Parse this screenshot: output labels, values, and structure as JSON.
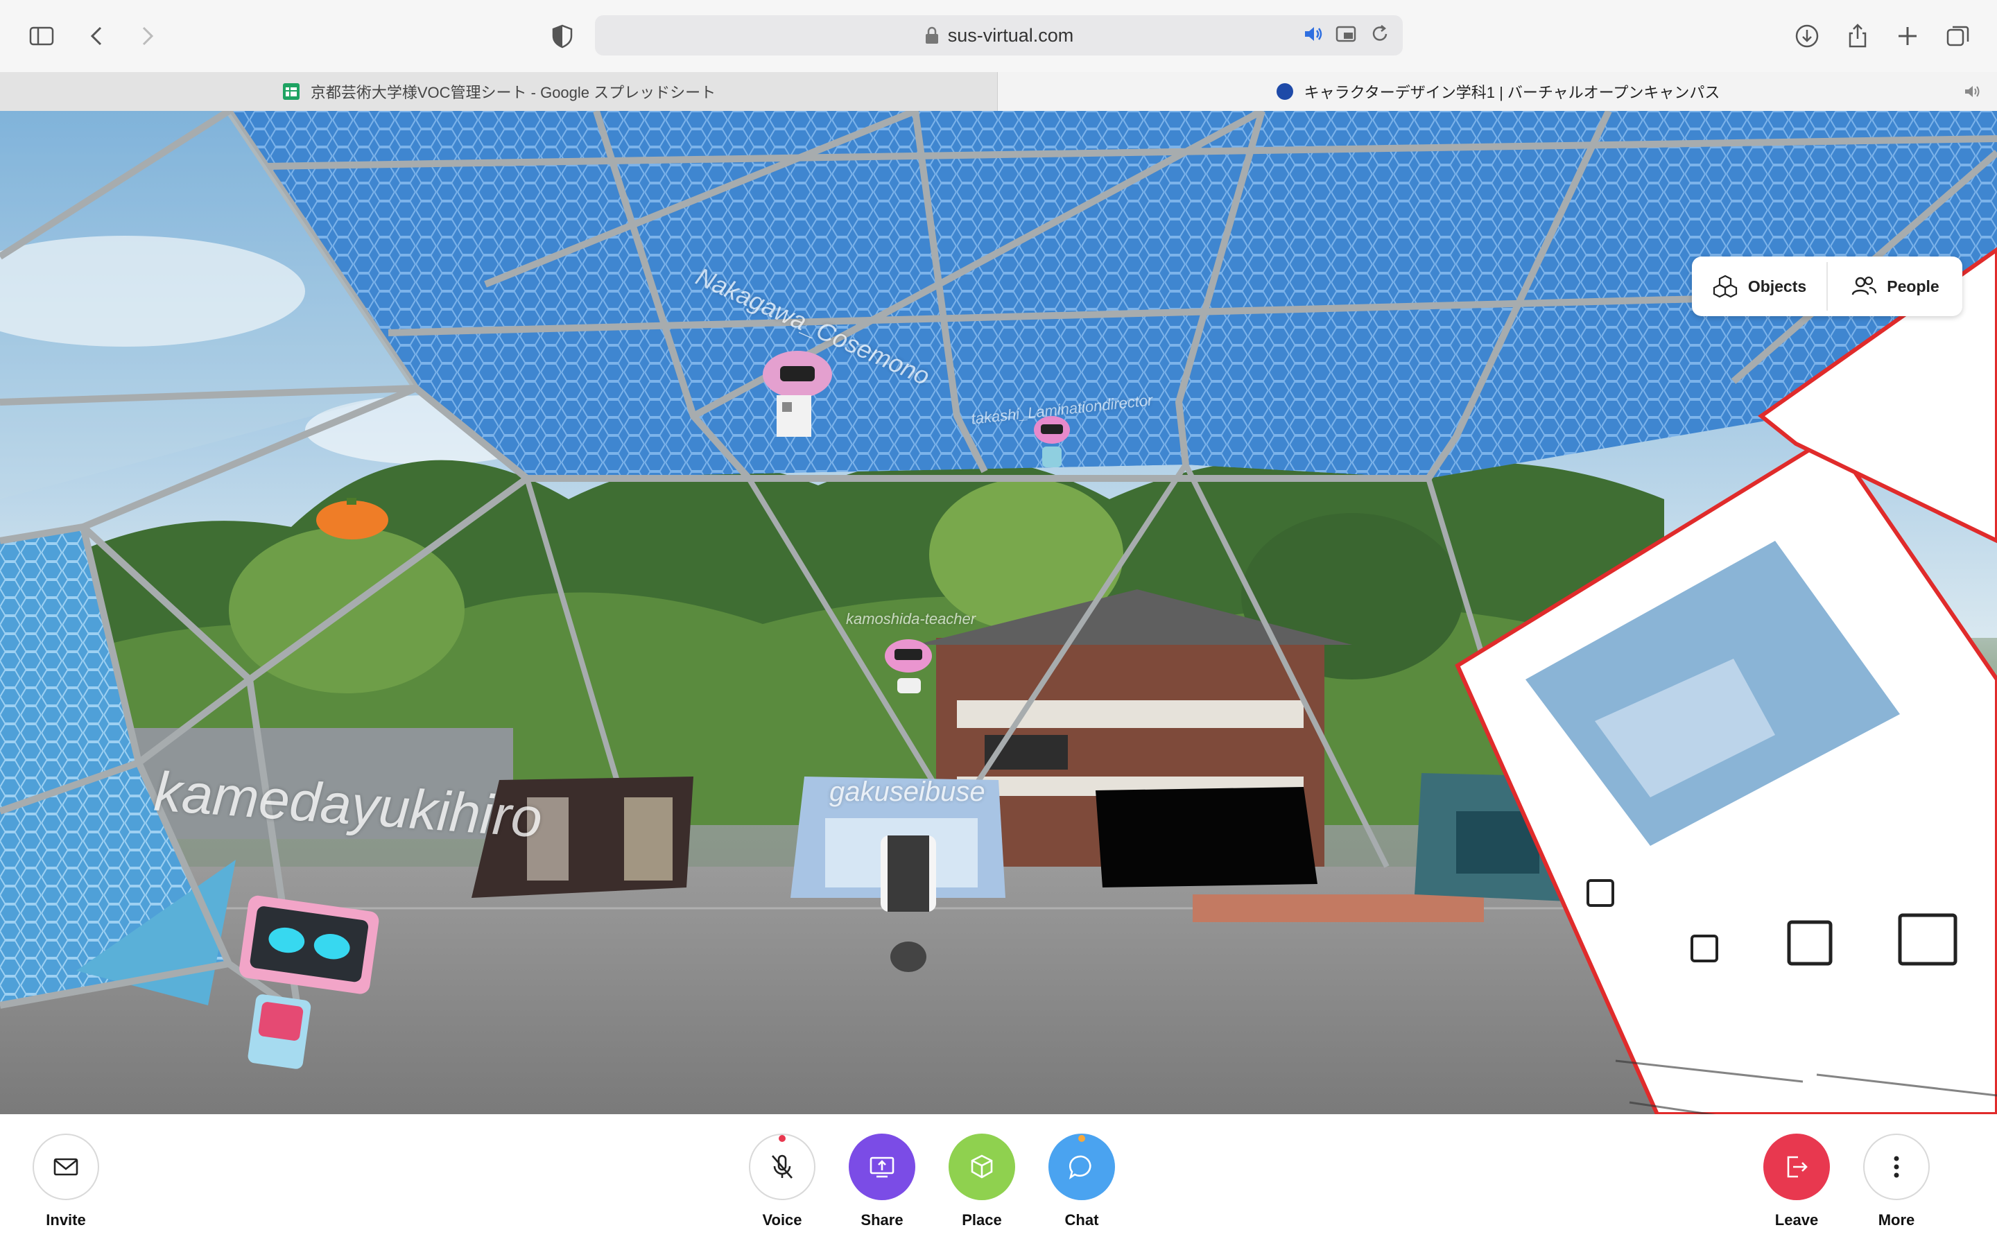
{
  "browser": {
    "url": "sus-virtual.com",
    "tabs": [
      {
        "title": "京都芸術大学様VOC管理シート - Google スプレッドシート",
        "active": false
      },
      {
        "title": "キャラクターデザイン学科1 | バーチャルオープンキャンパス",
        "active": true
      }
    ]
  },
  "scene": {
    "avatar_labels": {
      "kameda": "kamedayukihiro",
      "nakagawa": "Nakagawa_Cosemono",
      "takashi": "takashi_Laminationdirector",
      "kamoshida": "kamoshida-teacher",
      "gakusei": "gakuseibuse"
    }
  },
  "panel": {
    "objects_label": "Objects",
    "people_label": "People"
  },
  "bottom": {
    "invite": "Invite",
    "voice": "Voice",
    "share": "Share",
    "place": "Place",
    "chat": "Chat",
    "leave": "Leave",
    "more": "More"
  },
  "colors": {
    "share": "#7b4ce6",
    "place": "#8fd14f",
    "chat": "#4aa3f0",
    "leave": "#e8384f",
    "mic_dot": "#e8384f",
    "chat_dot": "#f7a83b"
  }
}
